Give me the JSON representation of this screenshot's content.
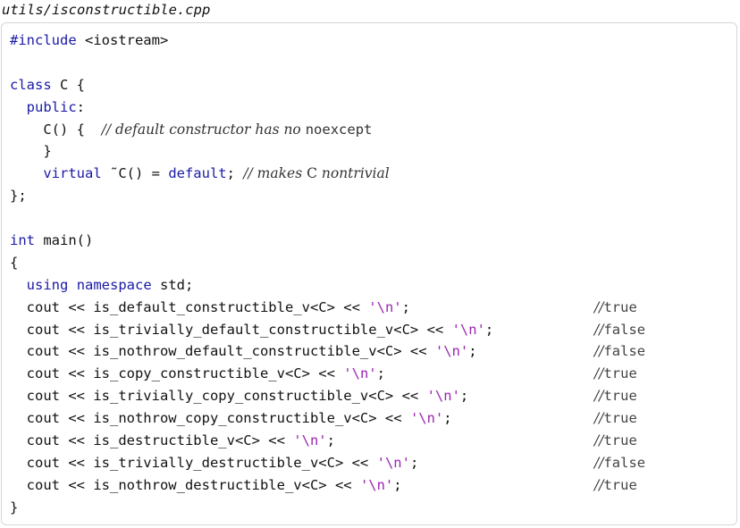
{
  "filename": "utils/isconstructible.cpp",
  "code": {
    "l1_kw": "#include",
    "l1_rest": " <iostream>",
    "l3_indent": "",
    "l3_kw": "class",
    "l3_rest": " C {",
    "l4_indent": "  ",
    "l4_kw": "public",
    "l4_rest": ":",
    "l5_code": "    C() {  ",
    "l5_comment": "// default constructor has no ",
    "l5_comment_mono": "noexcept",
    "l6_code": "    }",
    "l7_indent": "    ",
    "l7_kw1": "virtual",
    "l7_mid": " ˜C() = ",
    "l7_kw2": "default",
    "l7_end": "; ",
    "l7_comment_a": "// makes ",
    "l7_comment_mono": "C",
    "l7_comment_b": " nontrivial",
    "l8_code": "};",
    "l10_kw": "int",
    "l10_rest": " main()",
    "l11_code": "{",
    "l12_indent": "  ",
    "l12_kw1": "using",
    "l12_sp": " ",
    "l12_kw2": "namespace",
    "l12_rest": " std;",
    "l23_code": "}"
  },
  "rows": [
    {
      "code": "  cout << is_default_constructible_v<C> << ",
      "str": "'\\n'",
      "end": ";",
      "comment": "//",
      "value": "true"
    },
    {
      "code": "  cout << is_trivially_default_constructible_v<C> << ",
      "str": "'\\n'",
      "end": ";",
      "comment": "//",
      "value": "false"
    },
    {
      "code": "  cout << is_nothrow_default_constructible_v<C> << ",
      "str": "'\\n'",
      "end": ";",
      "comment": "//",
      "value": "false"
    },
    {
      "code": "  cout << is_copy_constructible_v<C> << ",
      "str": "'\\n'",
      "end": ";",
      "comment": "//",
      "value": "true"
    },
    {
      "code": "  cout << is_trivially_copy_constructible_v<C> << ",
      "str": "'\\n'",
      "end": ";",
      "comment": "//",
      "value": "true"
    },
    {
      "code": "  cout << is_nothrow_copy_constructible_v<C> << ",
      "str": "'\\n'",
      "end": ";",
      "comment": "//",
      "value": "true"
    },
    {
      "code": "  cout << is_destructible_v<C> << ",
      "str": "'\\n'",
      "end": ";",
      "comment": "//",
      "value": "true"
    },
    {
      "code": "  cout << is_trivially_destructible_v<C> << ",
      "str": "'\\n'",
      "end": ";",
      "comment": "//",
      "value": "false"
    },
    {
      "code": "  cout << is_nothrow_destructible_v<C> << ",
      "str": "'\\n'",
      "end": ";",
      "comment": "//",
      "value": "true"
    }
  ]
}
